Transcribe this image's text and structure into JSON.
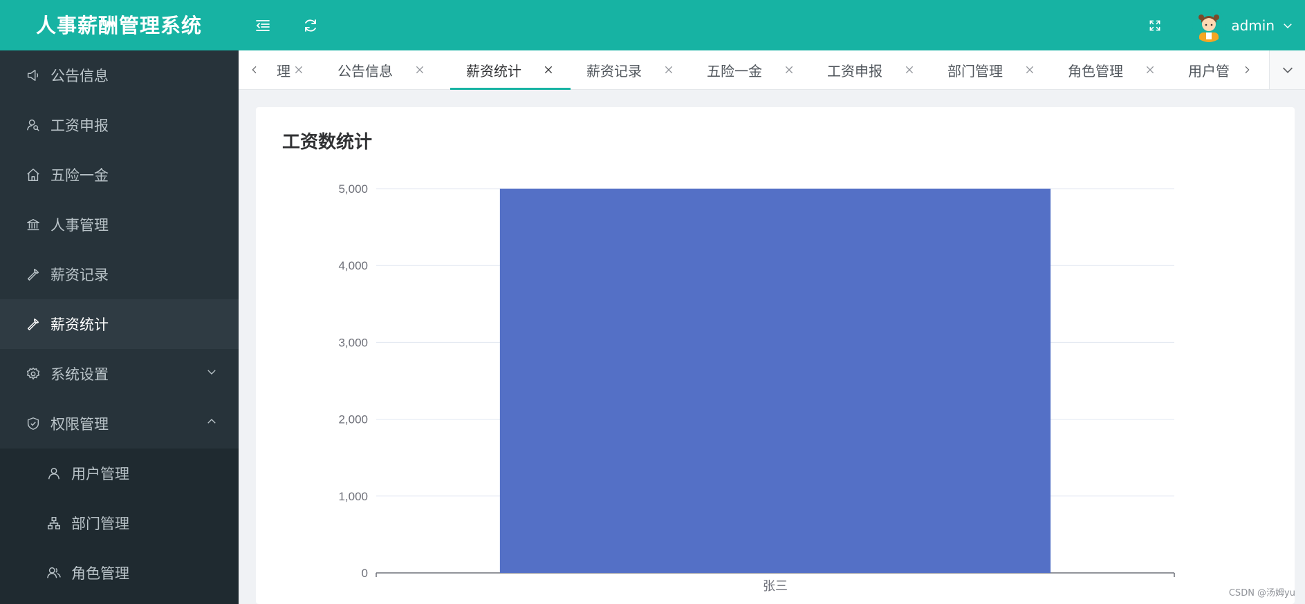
{
  "header": {
    "app_title": "人事薪酬管理系统",
    "username": "admin",
    "icons": {
      "collapse": "menu-fold-icon",
      "refresh": "refresh-icon",
      "fullscreen": "fullscreen-icon",
      "dropdown": "chevron-down-icon"
    }
  },
  "colors": {
    "header_bg": "#17b3a3",
    "sidebar_bg": "#27333a",
    "sidebar_active": "#2f3b43",
    "accent": "#17b3a3",
    "bar": "#5470c6"
  },
  "sidebar": {
    "items": [
      {
        "label": "公告信息",
        "icon": "megaphone-icon"
      },
      {
        "label": "工资申报",
        "icon": "user-search-icon"
      },
      {
        "label": "五险一金",
        "icon": "home-icon"
      },
      {
        "label": "人事管理",
        "icon": "bank-icon"
      },
      {
        "label": "薪资记录",
        "icon": "wrench-icon"
      },
      {
        "label": "薪资统计",
        "icon": "wrench-icon",
        "active": true
      },
      {
        "label": "系统设置",
        "icon": "gear-icon"
      },
      {
        "label": "权限管理",
        "icon": "shield-check-icon"
      }
    ],
    "sub_items": [
      {
        "label": "用户管理",
        "icon": "user-icon"
      },
      {
        "label": "部门管理",
        "icon": "org-chart-icon"
      },
      {
        "label": "角色管理",
        "icon": "users-icon"
      }
    ]
  },
  "tabs": {
    "items": [
      {
        "label": "理"
      },
      {
        "label": "公告信息"
      },
      {
        "label": "薪资统计",
        "active": true
      },
      {
        "label": "薪资记录"
      },
      {
        "label": "五险一金"
      },
      {
        "label": "工资申报"
      },
      {
        "label": "部门管理"
      },
      {
        "label": "角色管理"
      },
      {
        "label": "用户管"
      }
    ]
  },
  "card": {
    "title": "工资数统计"
  },
  "chart_data": {
    "type": "bar",
    "categories": [
      "张三"
    ],
    "values": [
      5000
    ],
    "ylim": [
      0,
      5000
    ],
    "yticks": [
      0,
      1000,
      2000,
      3000,
      4000,
      5000
    ],
    "ytick_labels": [
      "0",
      "1,000",
      "2,000",
      "3,000",
      "4,000",
      "5,000"
    ],
    "grid": true,
    "legend": "none"
  },
  "watermark": "CSDN @汤姆yu"
}
